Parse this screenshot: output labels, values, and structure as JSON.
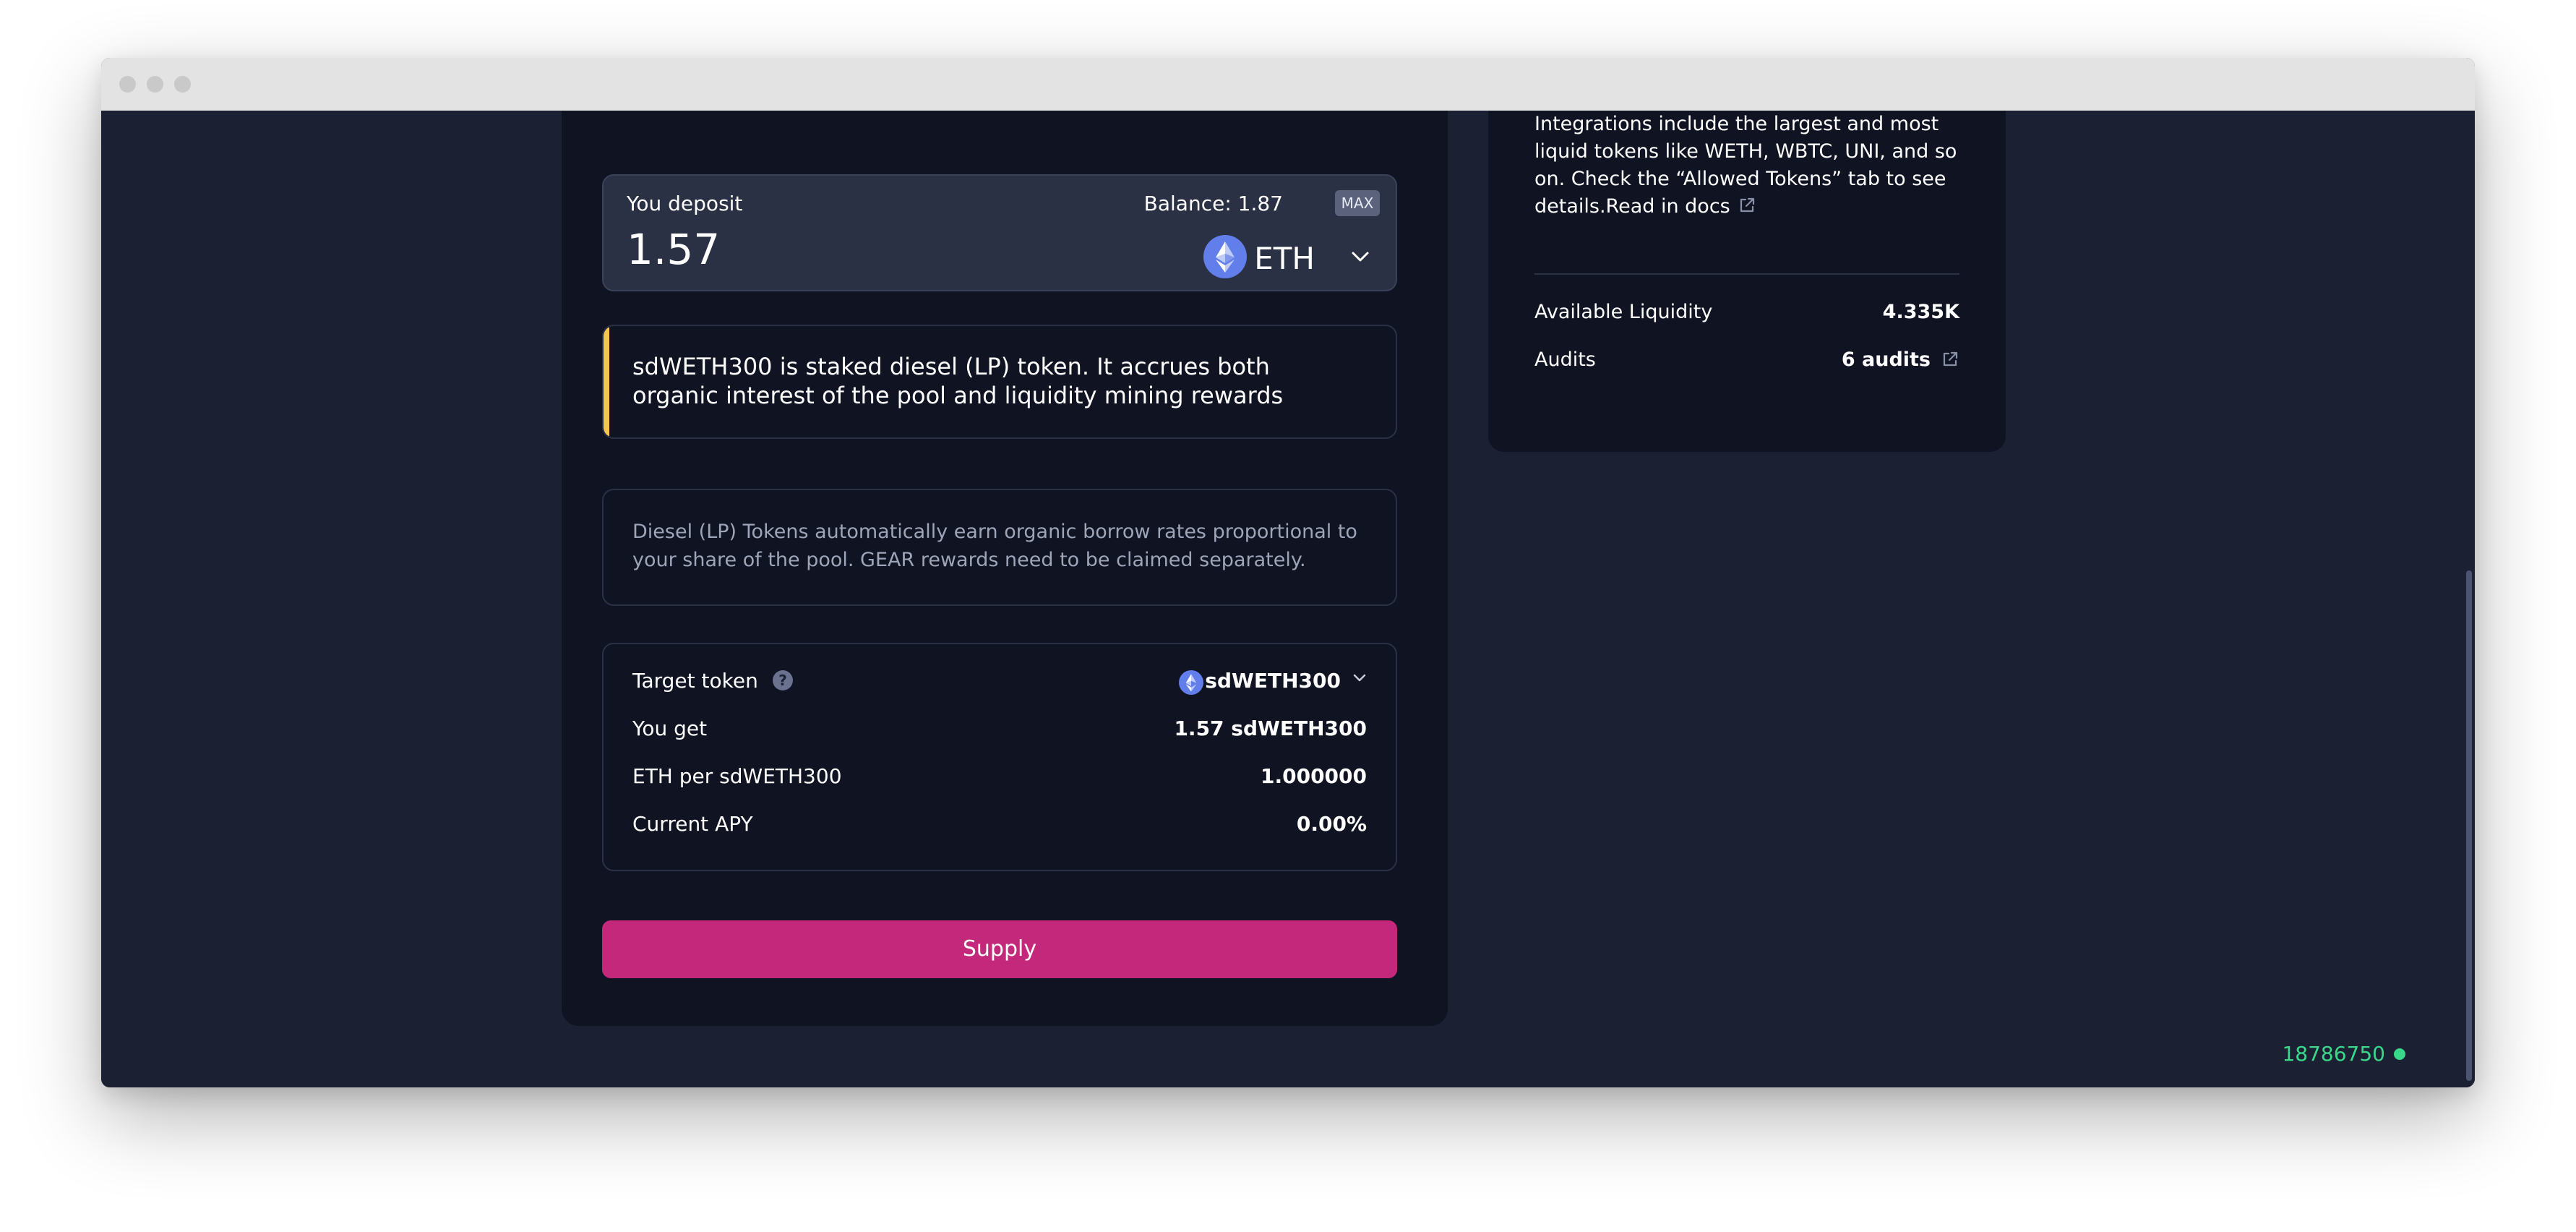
{
  "deposit": {
    "label": "You deposit",
    "balance": "Balance: 1.87",
    "max_label": "MAX",
    "amount": "1.57",
    "token": "ETH"
  },
  "notice": {
    "text": "sdWETH300 is staked diesel (LP) token. It accrues both organic interest of the pool and liquidity mining rewards",
    "accent_color": "#f5c451"
  },
  "info": {
    "text": "Diesel (LP) Tokens automatically earn organic borrow rates proportional to your share of the pool. GEAR rewards need to be claimed separately."
  },
  "details": {
    "target_token_label": "Target token",
    "target_token_value": "sdWETH300",
    "you_get_label": "You get",
    "you_get_value": "1.57 sdWETH300",
    "rate_label": "ETH per sdWETH300",
    "rate_value": "1.000000",
    "apy_label": "Current APY",
    "apy_value": "0.00%"
  },
  "supply_button": {
    "label": "Supply",
    "color": "#c4287a"
  },
  "side": {
    "description": "Integrations include the largest and most liquid tokens like WETH, WBTC, UNI, and so on. Check the “Allowed Tokens” tab to see details.",
    "docs_link": "Read in docs",
    "liquidity_label": "Available Liquidity",
    "liquidity_value": "4.335K",
    "audits_label": "Audits",
    "audits_value": "6 audits"
  },
  "status": {
    "block_number": "18786750",
    "status_color": "#39d98a"
  },
  "icons": [
    "ethereum-icon",
    "chevron-down-icon",
    "help-icon",
    "external-link-icon",
    "status-dot-icon"
  ]
}
